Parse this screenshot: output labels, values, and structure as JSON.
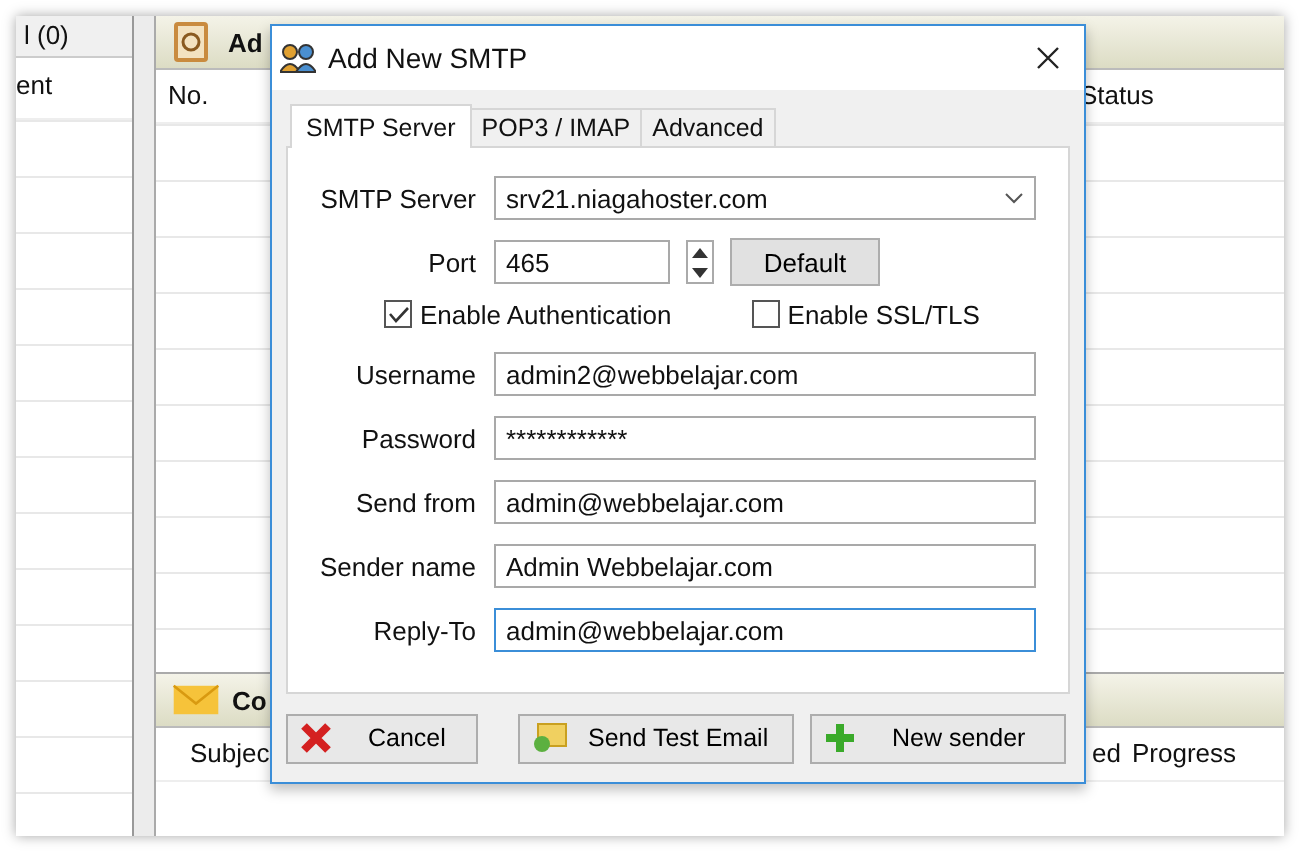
{
  "background": {
    "left_panel": {
      "header": "l (0)",
      "column": "ent"
    },
    "top_panel": {
      "title": "Ad",
      "columns": [
        "No.",
        "Status"
      ]
    },
    "bottom_panel": {
      "title": "Co",
      "columns": [
        "Subjec",
        "ed",
        "Progress"
      ]
    }
  },
  "dialog": {
    "title": "Add New SMTP",
    "tabs": [
      {
        "label": "SMTP Server",
        "selected": true
      },
      {
        "label": "POP3 / IMAP",
        "selected": false
      },
      {
        "label": "Advanced",
        "selected": false
      }
    ],
    "server": {
      "label": "SMTP Server",
      "value": "srv21.niagahoster.com"
    },
    "port": {
      "label": "Port",
      "value": "465",
      "button": "Default"
    },
    "checkboxes": [
      {
        "label": "Enable Authentication",
        "checked": true
      },
      {
        "label": "Enable SSL/TLS",
        "checked": false
      }
    ],
    "fields": [
      {
        "label": "Username",
        "value": "admin2@webbelajar.com",
        "focused": false
      },
      {
        "label": "Password",
        "value": "************",
        "focused": false
      },
      {
        "label": "Send from",
        "value": "admin@webbelajar.com",
        "focused": false
      },
      {
        "label": "Sender name",
        "value": "Admin Webbelajar.com",
        "focused": false
      },
      {
        "label": "Reply-To",
        "value": "admin@webbelajar.com",
        "focused": true
      }
    ],
    "buttons": [
      {
        "label": "Cancel",
        "kind": "cancel"
      },
      {
        "label": "Send Test Email",
        "kind": "test"
      },
      {
        "label": "New sender",
        "kind": "add"
      }
    ]
  }
}
